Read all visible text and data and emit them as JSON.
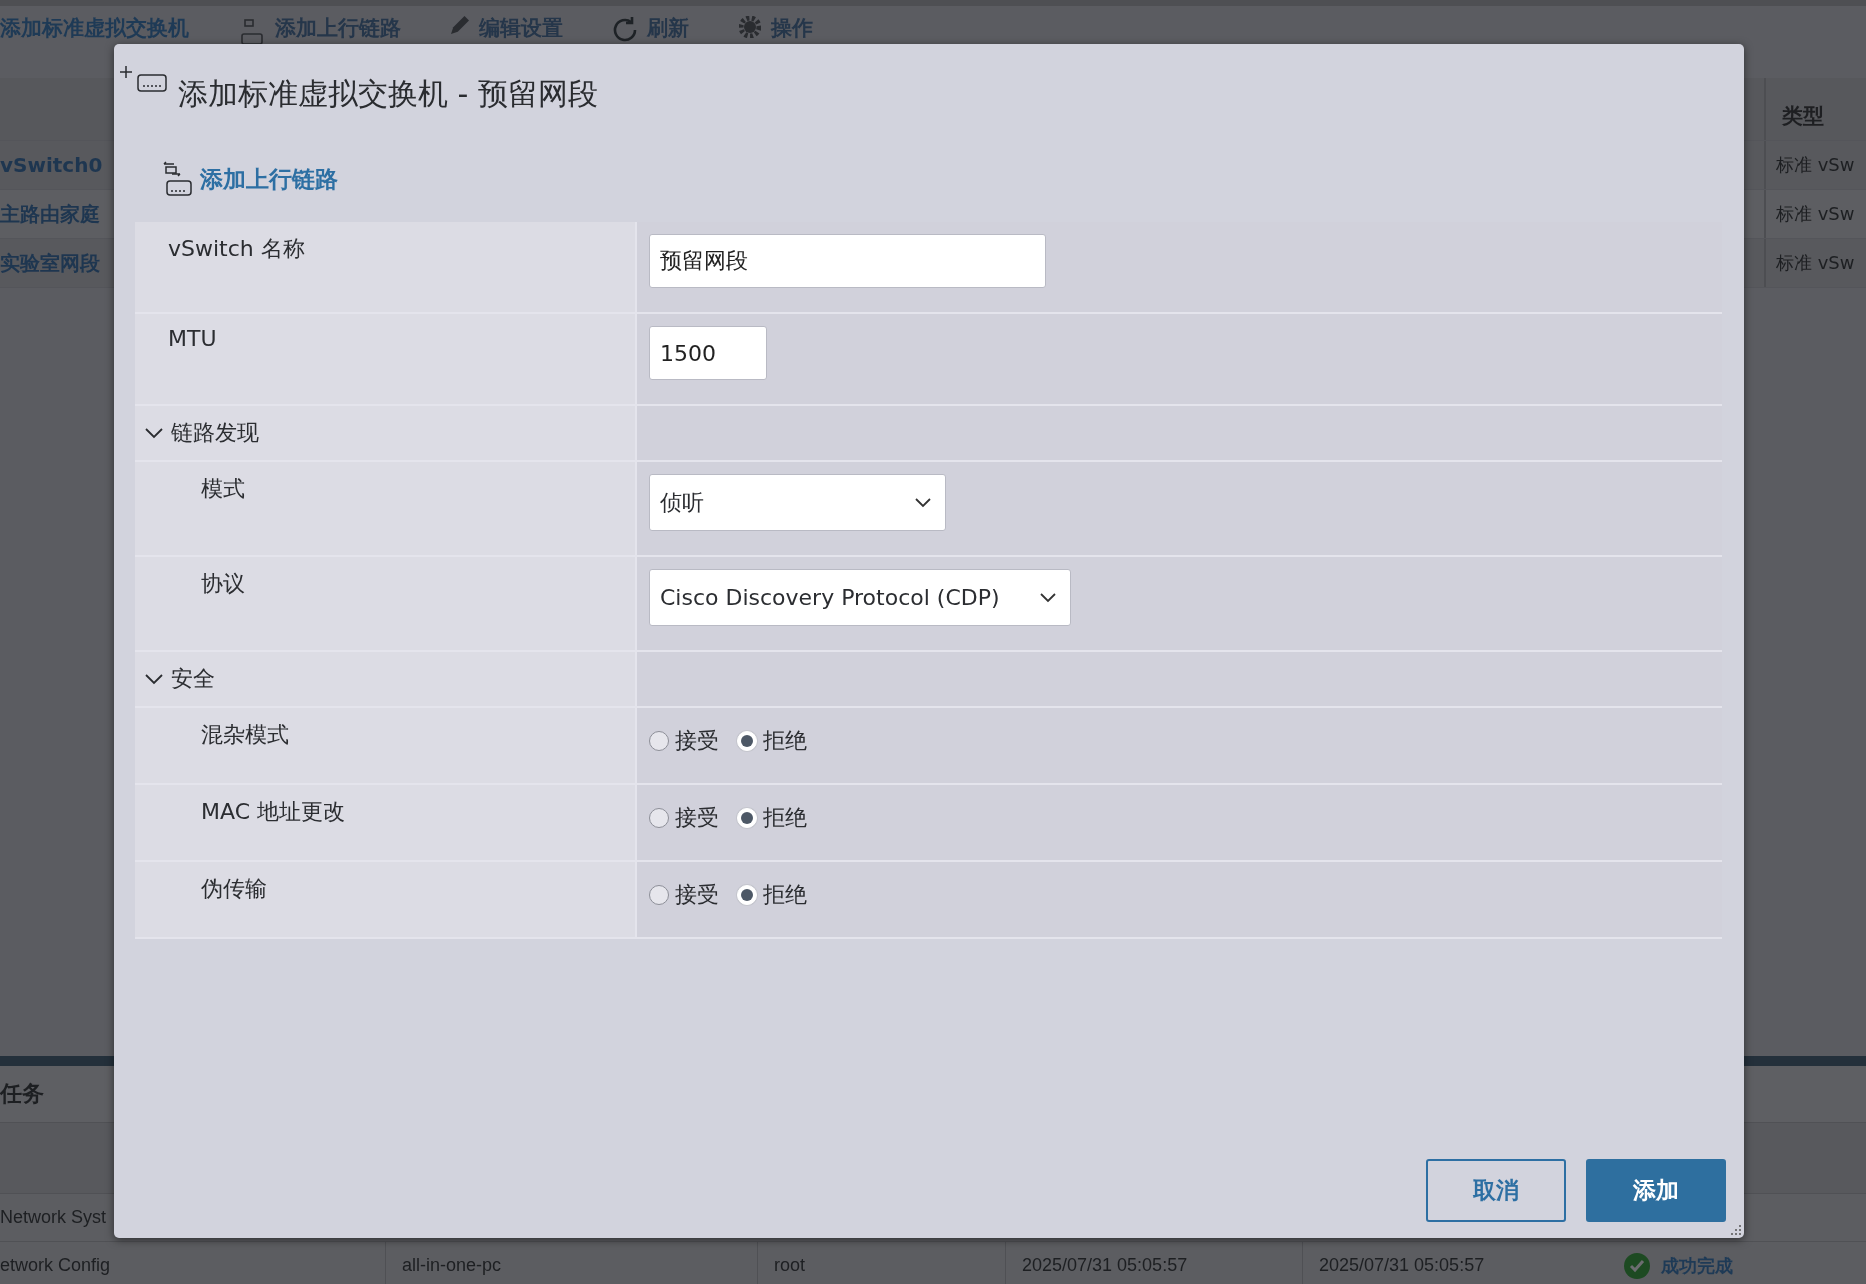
{
  "background": {
    "toolbar": [
      {
        "kind": "link",
        "label": "添加标准虚拟交换机"
      },
      {
        "kind": "uplink",
        "label": "添加上行链路"
      },
      {
        "kind": "edit",
        "label": "编辑设置"
      },
      {
        "kind": "refresh",
        "label": "刷新"
      },
      {
        "kind": "actions",
        "label": "操作"
      }
    ],
    "switch_table": {
      "column": "类型",
      "rows": [
        {
          "name": "vSwitch0",
          "type": "标准 vSw"
        },
        {
          "name": "主路由家庭",
          "type": "标准 vSw"
        },
        {
          "name": "实验室网段",
          "type": "标准 vSw"
        }
      ]
    },
    "tasks": {
      "title": "任务",
      "rows": [
        {
          "cells": [
            "Network Syst"
          ]
        },
        {
          "cells": [
            "etwork Config",
            "all-in-one-pc",
            "root",
            "2025/07/31 05:05:57",
            "2025/07/31 05:05:57"
          ],
          "status": "成功完成"
        }
      ]
    }
  },
  "dialog": {
    "title": "添加标准虚拟交换机 - 预留网段",
    "add_uplink": "添加上行链路",
    "rows": [
      {
        "kind": "text",
        "label": "vSwitch 名称",
        "value": "预留网段"
      },
      {
        "kind": "number",
        "label": "MTU",
        "value": "1500"
      },
      {
        "kind": "section",
        "label": "链路发现",
        "expanded": true,
        "children": [
          {
            "kind": "select",
            "label": "模式",
            "value": "侦听"
          },
          {
            "kind": "select",
            "label": "协议",
            "value": "Cisco Discovery Protocol (CDP)"
          }
        ]
      },
      {
        "kind": "section",
        "label": "安全",
        "expanded": true,
        "children": [
          {
            "kind": "radio",
            "label": "混杂模式",
            "options": [
              {
                "label": "接受",
                "selected": false
              },
              {
                "label": "拒绝",
                "selected": true
              }
            ]
          },
          {
            "kind": "radio",
            "label": "MAC 地址更改",
            "options": [
              {
                "label": "接受",
                "selected": false
              },
              {
                "label": "拒绝",
                "selected": true
              }
            ]
          },
          {
            "kind": "radio",
            "label": "伪传输",
            "options": [
              {
                "label": "接受",
                "selected": false
              },
              {
                "label": "拒绝",
                "selected": true
              }
            ]
          }
        ]
      }
    ],
    "buttons": [
      {
        "kind": "secondary",
        "label": "取消"
      },
      {
        "kind": "primary",
        "label": "添加"
      }
    ]
  }
}
